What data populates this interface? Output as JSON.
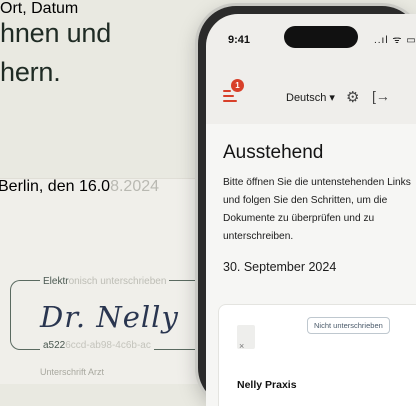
{
  "headline": {
    "line1": "hnen und",
    "line2": "hern."
  },
  "signature_card": {
    "city": "Berlin, den ",
    "date_dark": "16.0",
    "date_light": "8.2024",
    "place_date_label": "Ort, Datum",
    "signed_label_dark": "Elektr",
    "signed_label_light": "onisch unterschrieben",
    "signature": "Dr. Nelly",
    "hash_dark": "a522",
    "hash_light": "6ccd-ab98-4c6b-ac",
    "signature_label": "Unterschrift Arzt"
  },
  "phone": {
    "status_time": "9:41",
    "status_icons": "..ıl ᯤ ▭",
    "menu_badge": "1",
    "language": "Deutsch",
    "language_caret": "▾",
    "gear_glyph": "⚙",
    "logout_glyph": "[→",
    "heading": "Ausstehend",
    "intro": "Bitte öffnen Sie die untenstehenden Links und folgen Sie den Schritten, um die Dokumente zu überprüfen und zu unterschreiben.",
    "date_heading": "30. September 2024",
    "document": {
      "status": "Nicht unterschrieben",
      "icon_mark": "×",
      "practice": "Nelly Praxis"
    }
  },
  "colors": {
    "background": "#e9e9e1",
    "accent": "#d8402a",
    "signature_ink": "#2a3650"
  }
}
